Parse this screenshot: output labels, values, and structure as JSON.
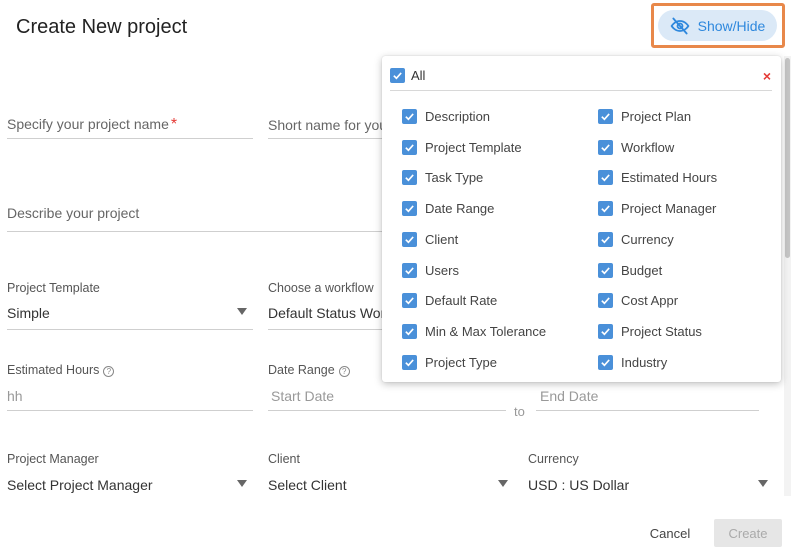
{
  "page": {
    "title": "Create New project"
  },
  "toolbar": {
    "show_hide_label": "Show/Hide"
  },
  "form": {
    "project_name_placeholder": "Specify your project name",
    "required_mark": "*",
    "short_name_placeholder": "Short name for you",
    "description_placeholder": "Describe your project",
    "project_template": {
      "label": "Project Template",
      "value": "Simple"
    },
    "workflow": {
      "label": "Choose a workflow",
      "value": "Default Status Wor"
    },
    "estimated_hours": {
      "label": "Estimated Hours",
      "placeholder": "hh"
    },
    "date_range": {
      "label": "Date Range",
      "start_placeholder": "Start Date",
      "separator": "to",
      "end_placeholder": "End Date"
    },
    "project_manager": {
      "label": "Project Manager",
      "value": "Select Project Manager"
    },
    "client": {
      "label": "Client",
      "value": "Select Client"
    },
    "currency": {
      "label": "Currency",
      "value": "USD : US Dollar"
    }
  },
  "panel": {
    "all_label": "All",
    "close_glyph": "×",
    "left": [
      "Description",
      "Project Template",
      "Task Type",
      "Date Range",
      "Client",
      "Users",
      "Default Rate",
      "Min & Max Tolerance",
      "Project Type"
    ],
    "right": [
      "Project Plan",
      "Workflow",
      "Estimated Hours",
      "Project Manager",
      "Currency",
      "Budget",
      "Cost Appr",
      "Project Status",
      "Industry"
    ]
  },
  "actions": {
    "cancel": "Cancel",
    "create": "Create"
  },
  "colors": {
    "accent": "#2e88dd",
    "checkbox": "#4a90d9",
    "required": "#e53935",
    "highlight": "#e8884a"
  },
  "icons": {
    "show_hide": "eye-slash-icon",
    "checkbox": "check-icon",
    "info": "info-icon",
    "dropdown": "caret-down-icon"
  }
}
